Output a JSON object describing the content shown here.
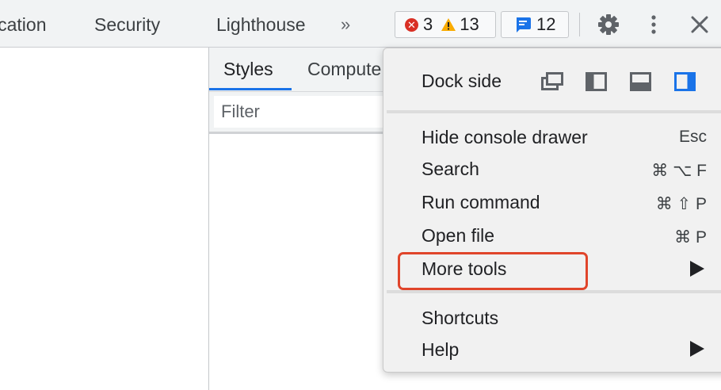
{
  "tabbar": {
    "tabs": [
      "ication",
      "Security",
      "Lighthouse"
    ],
    "overflow_label": "»",
    "errors_count": "3",
    "warnings_count": "13",
    "issues_count": "12",
    "icons": [
      "error-icon",
      "warning-icon",
      "message-icon",
      "gear-icon",
      "kebab-icon",
      "close-icon"
    ]
  },
  "panel": {
    "subtabs": [
      "Styles",
      "Compute"
    ],
    "filter_placeholder": "Filter"
  },
  "menu": {
    "dock_label": "Dock side",
    "dock_options": [
      "undock-into-separate-window",
      "dock-to-left",
      "dock-to-bottom",
      "dock-to-right"
    ],
    "dock_selected": "dock-to-right",
    "items": [
      {
        "label": "Hide console drawer",
        "shortcut": "Esc"
      },
      {
        "label": "Search",
        "shortcut": "⌘ ⌥ F"
      },
      {
        "label": "Run command",
        "shortcut": "⌘ ⇧ P"
      },
      {
        "label": "Open file",
        "shortcut": "⌘ P"
      },
      {
        "label": "More tools",
        "submenu": true
      },
      {
        "label": "Shortcuts"
      },
      {
        "label": "Help",
        "submenu": true
      }
    ]
  },
  "colors": {
    "accent": "#1a73e8",
    "error": "#d93025",
    "warning": "#f9ab00",
    "highlight": "#e0452b"
  }
}
